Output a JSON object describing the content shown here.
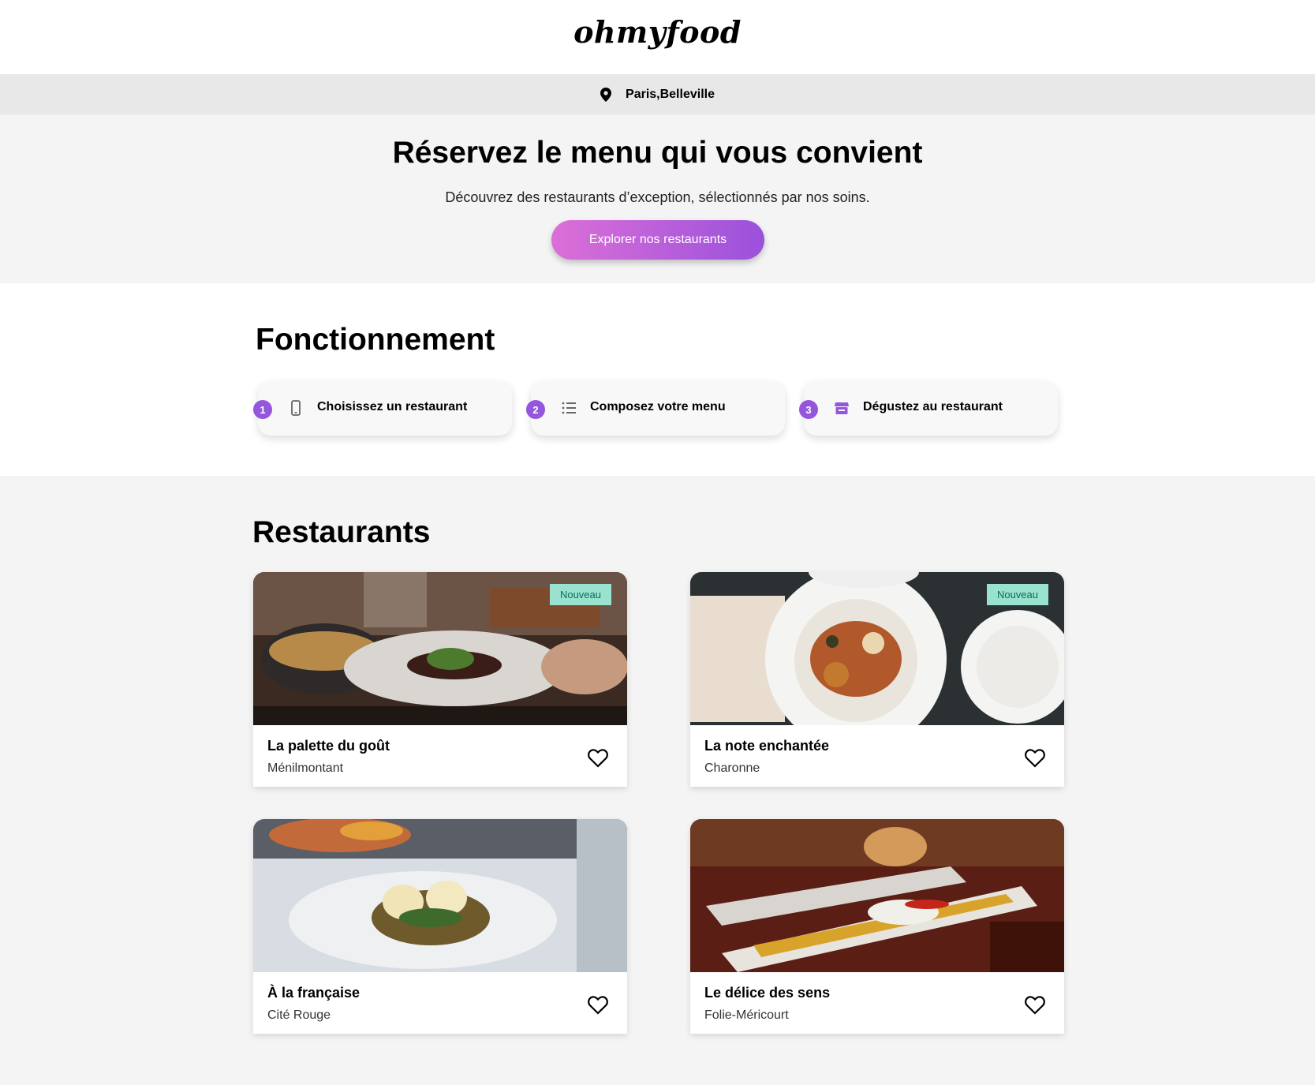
{
  "header": {
    "logo": "ohmyfood"
  },
  "location": {
    "icon": "map-pin-icon",
    "text": "Paris,Belleville"
  },
  "hero": {
    "title": "Réservez le menu qui vous convient",
    "subtitle": "Découvrez des restaurants d’exception, sélectionnés par nos soins.",
    "cta_label": "Explorer nos restaurants"
  },
  "how": {
    "title": "Fonctionnement",
    "steps": [
      {
        "number": "1",
        "icon": "phone-icon",
        "label": "Choisissez un restaurant"
      },
      {
        "number": "2",
        "icon": "list-icon",
        "label": "Composez votre menu"
      },
      {
        "number": "3",
        "icon": "store-icon",
        "label": "Dégustez au restaurant"
      }
    ]
  },
  "restaurants": {
    "title": "Restaurants",
    "items": [
      {
        "name": "La palette du goût",
        "area": "Ménilmontant",
        "badge": "Nouveau"
      },
      {
        "name": "La note enchantée",
        "area": "Charonne",
        "badge": "Nouveau"
      },
      {
        "name": "À la française",
        "area": "Cité Rouge"
      },
      {
        "name": "Le délice des sens",
        "area": "Folie-Méricourt"
      }
    ]
  },
  "colors": {
    "accent": "#9356dc",
    "cta_start": "#dc6fd8",
    "cta_end": "#9a51db",
    "badge_bg": "#99e2d0",
    "badge_text": "#0d6b55"
  }
}
